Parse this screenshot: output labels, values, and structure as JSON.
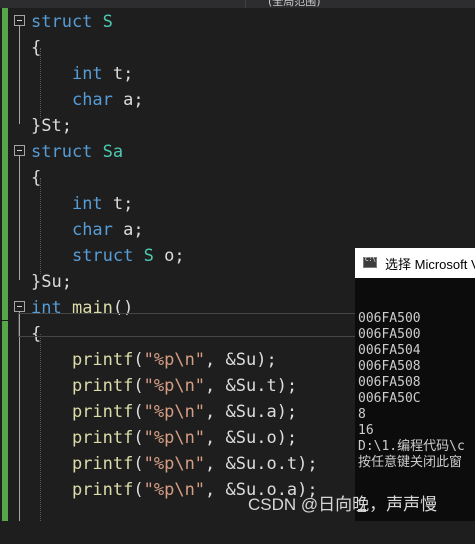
{
  "tab_title": "(全局范围)",
  "code": [
    {
      "tokens": [
        {
          "t": "struct",
          "c": "kw"
        },
        {
          "t": " "
        },
        {
          "t": "S",
          "c": "ty"
        }
      ]
    },
    {
      "tokens": [
        {
          "t": "{"
        }
      ]
    },
    {
      "tokens": [
        {
          "t": "    "
        },
        {
          "t": "int",
          "c": "kw"
        },
        {
          "t": " t;"
        }
      ]
    },
    {
      "tokens": [
        {
          "t": "    "
        },
        {
          "t": "char",
          "c": "kw"
        },
        {
          "t": " a;"
        }
      ]
    },
    {
      "tokens": [
        {
          "t": "}St;"
        }
      ]
    },
    {
      "tokens": [
        {
          "t": "struct",
          "c": "kw"
        },
        {
          "t": " "
        },
        {
          "t": "Sa",
          "c": "ty"
        }
      ]
    },
    {
      "tokens": [
        {
          "t": "{"
        }
      ]
    },
    {
      "tokens": [
        {
          "t": "    "
        },
        {
          "t": "int",
          "c": "kw"
        },
        {
          "t": " t;"
        }
      ]
    },
    {
      "tokens": [
        {
          "t": "    "
        },
        {
          "t": "char",
          "c": "kw"
        },
        {
          "t": " a;"
        }
      ]
    },
    {
      "tokens": [
        {
          "t": "    "
        },
        {
          "t": "struct",
          "c": "kw"
        },
        {
          "t": " "
        },
        {
          "t": "S",
          "c": "ty"
        },
        {
          "t": " o;"
        }
      ]
    },
    {
      "tokens": [
        {
          "t": "}Su;"
        }
      ]
    },
    {
      "tokens": [
        {
          "t": "int",
          "c": "kw"
        },
        {
          "t": " "
        },
        {
          "t": "main",
          "c": "fn"
        },
        {
          "t": "()"
        }
      ]
    },
    {
      "tokens": [
        {
          "t": "{"
        }
      ]
    },
    {
      "tokens": [
        {
          "t": "    "
        },
        {
          "t": "printf",
          "c": "fn"
        },
        {
          "t": "("
        },
        {
          "t": "\"%p\\n\"",
          "c": "str"
        },
        {
          "t": ", &Su);"
        }
      ]
    },
    {
      "tokens": [
        {
          "t": "    "
        },
        {
          "t": "printf",
          "c": "fn"
        },
        {
          "t": "("
        },
        {
          "t": "\"%p\\n\"",
          "c": "str"
        },
        {
          "t": ", &Su.t);"
        }
      ]
    },
    {
      "tokens": [
        {
          "t": "    "
        },
        {
          "t": "printf",
          "c": "fn"
        },
        {
          "t": "("
        },
        {
          "t": "\"%p\\n\"",
          "c": "str"
        },
        {
          "t": ", &Su.a);"
        }
      ]
    },
    {
      "tokens": [
        {
          "t": "    "
        },
        {
          "t": "printf",
          "c": "fn"
        },
        {
          "t": "("
        },
        {
          "t": "\"%p\\n\"",
          "c": "str"
        },
        {
          "t": ", &Su.o);"
        }
      ]
    },
    {
      "tokens": [
        {
          "t": "    "
        },
        {
          "t": "printf",
          "c": "fn"
        },
        {
          "t": "("
        },
        {
          "t": "\"%p\\n\"",
          "c": "str"
        },
        {
          "t": ", &Su.o.t);"
        }
      ]
    },
    {
      "tokens": [
        {
          "t": "    "
        },
        {
          "t": "printf",
          "c": "fn"
        },
        {
          "t": "("
        },
        {
          "t": "\"%p\\n\"",
          "c": "str"
        },
        {
          "t": ", &Su.o.a);"
        }
      ]
    }
  ],
  "console": {
    "title": "选择 Microsoft V",
    "output": [
      "006FA500",
      "006FA500",
      "006FA504",
      "006FA508",
      "006FA508",
      "006FA50C",
      "8",
      "16",
      "D:\\1.编程代码\\c",
      "按任意键关闭此窗"
    ]
  },
  "colors": {
    "background": "#1e1e1e",
    "keyword": "#569cd6",
    "type": "#4ec9b0",
    "string": "#d69d85",
    "function": "#dcdcaa",
    "change_marker": "#57a64a"
  },
  "icons": [
    "fold-collapse-icon",
    "console-app-icon"
  ],
  "watermark": "CSDN @日向晚，声声慢"
}
